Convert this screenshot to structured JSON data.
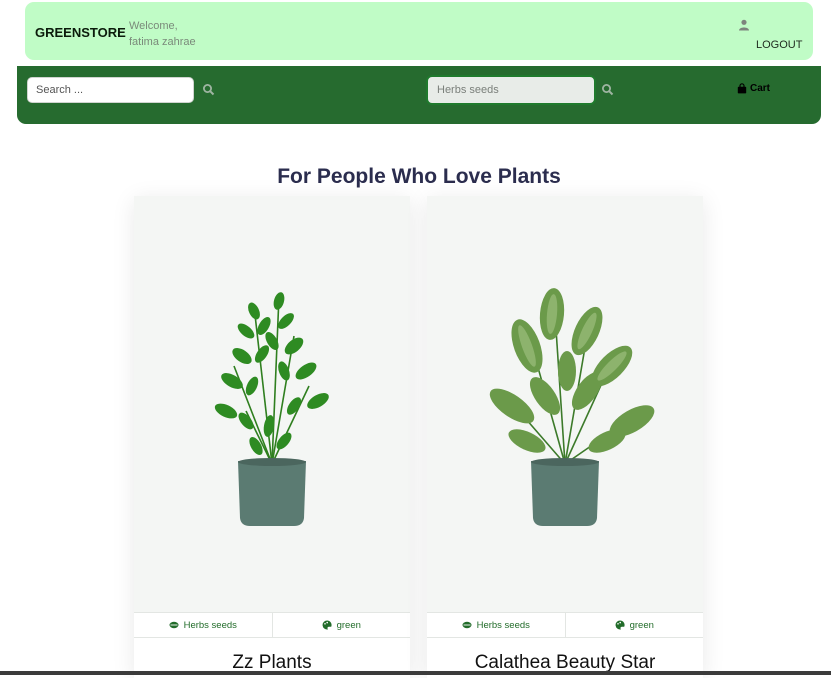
{
  "header": {
    "brand": "GREENSTORE",
    "welcome_line1": "Welcome,",
    "welcome_line2": "fatima zahrae",
    "logout_label": "LOGOUT"
  },
  "nav": {
    "search_placeholder": "Search ...",
    "category_selected": "Herbs seeds",
    "cart_label": "Cart"
  },
  "main": {
    "heading": "For People Who Love Plants",
    "products": [
      {
        "title": "Zz Plants",
        "category": "Herbs seeds",
        "color": "green"
      },
      {
        "title": "Calathea Beauty Star",
        "category": "Herbs seeds",
        "color": "green"
      }
    ]
  },
  "colors": {
    "topbar": "#c0fcc6",
    "navbar": "#266b2f",
    "accent_text": "#226c2a",
    "heading": "#2b2d4e"
  },
  "icons": [
    "user-icon",
    "search-icon",
    "bag-icon",
    "seed-icon",
    "palette-icon"
  ]
}
